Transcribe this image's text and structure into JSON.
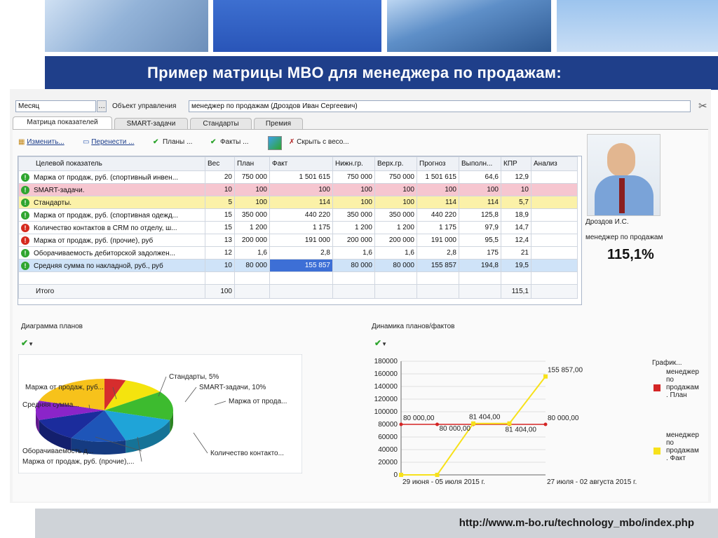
{
  "slide": {
    "title": "Пример матрицы MBO для менеджера по продажам:",
    "url": "http://www.m-bo.ru/technology_mbo/index.php"
  },
  "header": {
    "period_value": "Месяц",
    "object_label": "Объект управления",
    "object_value": "менеджер по продажам (Дроздов Иван Сергеевич)"
  },
  "tabs": [
    "Матрица показателей",
    "SMART-задачи",
    "Стандарты",
    "Премия"
  ],
  "toolbar": {
    "edit": "Изменить...",
    "move": "Перенести ...",
    "plans": "Планы ...",
    "facts": "Факты ...",
    "hide": "Скрыть с весо..."
  },
  "table": {
    "columns": [
      "Целевой показатель",
      "Вес",
      "План",
      "Факт",
      "Нижн.гр.",
      "Верх.гр.",
      "Прогноз",
      "Выполн...",
      "КПР",
      "Анализ"
    ],
    "rows": [
      {
        "status": "green",
        "name": "Маржа от продаж, руб. (спортивный инвен...",
        "weight": "20",
        "plan": "750 000",
        "fact": "1 501 615",
        "low": "750 000",
        "high": "750 000",
        "forecast": "1 501 615",
        "done": "64,6",
        "kpr": "12,9",
        "analysis": "",
        "style": ""
      },
      {
        "status": "green",
        "name": "SMART-задачи.",
        "weight": "10",
        "plan": "100",
        "fact": "100",
        "low": "100",
        "high": "100",
        "forecast": "100",
        "done": "100",
        "kpr": "10",
        "analysis": "",
        "style": "pink"
      },
      {
        "status": "green",
        "name": "Стандарты.",
        "weight": "5",
        "plan": "100",
        "fact": "114",
        "low": "100",
        "high": "100",
        "forecast": "114",
        "done": "114",
        "kpr": "5,7",
        "analysis": "",
        "style": "yellow"
      },
      {
        "status": "green",
        "name": "Маржа от продаж, руб. (спортивная одежд...",
        "weight": "15",
        "plan": "350 000",
        "fact": "440 220",
        "low": "350 000",
        "high": "350 000",
        "forecast": "440 220",
        "done": "125,8",
        "kpr": "18,9",
        "analysis": "",
        "style": ""
      },
      {
        "status": "red",
        "name": "Количество контактов в CRM по отделу, ш...",
        "weight": "15",
        "plan": "1 200",
        "fact": "1 175",
        "low": "1 200",
        "high": "1 200",
        "forecast": "1 175",
        "done": "97,9",
        "kpr": "14,7",
        "analysis": "",
        "style": ""
      },
      {
        "status": "red",
        "name": "Маржа от продаж, руб. (прочие), руб",
        "weight": "13",
        "plan": "200 000",
        "fact": "191 000",
        "low": "200 000",
        "high": "200 000",
        "forecast": "191 000",
        "done": "95,5",
        "kpr": "12,4",
        "analysis": "",
        "style": ""
      },
      {
        "status": "green",
        "name": "Оборачиваемость дебиторской задолжен...",
        "weight": "12",
        "plan": "1,6",
        "fact": "2,8",
        "low": "1,6",
        "high": "1,6",
        "forecast": "2,8",
        "done": "175",
        "kpr": "21",
        "analysis": "",
        "style": ""
      },
      {
        "status": "green",
        "name": "Средняя сумма по накладной, руб., руб",
        "weight": "10",
        "plan": "80 000",
        "fact": "155 857",
        "low": "80 000",
        "high": "80 000",
        "forecast": "155 857",
        "done": "194,8",
        "kpr": "19,5",
        "analysis": "",
        "style": "blue"
      }
    ],
    "total": {
      "name": "Итого",
      "weight": "100",
      "kpr": "115,1"
    }
  },
  "employee": {
    "name": "Дроздов И.С.",
    "role": "менеджер по продажам",
    "score": "115,1%"
  },
  "pie_chart": {
    "title": "Диаграмма планов",
    "slices": [
      {
        "label": "Стандарты, 5%",
        "value": 5,
        "color": "#d62d2d"
      },
      {
        "label": "SMART-задачи, 10%",
        "value": 10,
        "color": "#f4e40e"
      },
      {
        "label": "Маржа от прода...",
        "value": 15,
        "color": "#3dbb2f"
      },
      {
        "label": "Количество контакто...",
        "value": 15,
        "color": "#1fa4d8"
      },
      {
        "label": "Маржа от продаж, руб. (прочие),...",
        "value": 13,
        "color": "#1e55b8"
      },
      {
        "label": "Оборачиваемость д...",
        "value": 12,
        "color": "#1b2c9c"
      },
      {
        "label": "Средняя сумма...",
        "value": 10,
        "color": "#8b24c9"
      },
      {
        "label": "Маржа от продаж, руб...",
        "value": 20,
        "color": "#f7c21b"
      }
    ]
  },
  "line_chart": {
    "title": "Динамика планов/фактов",
    "legend_title": "График...",
    "y_ticks": [
      "180000",
      "160000",
      "140000",
      "120000",
      "100000",
      "80000",
      "60000",
      "40000",
      "20000",
      "0"
    ],
    "x_labels": [
      "29 июня - 05 июля 2015 г.",
      "27 июля - 02 августа 2015 г."
    ],
    "series": [
      {
        "name": "менеджер по продажам . План",
        "color": "#d42525",
        "values": [
          80000,
          80000,
          80000,
          80000,
          80000
        ]
      },
      {
        "name": "менеджер по продажам . Факт",
        "color": "#f7e11b",
        "values": [
          0,
          0,
          81404,
          81404,
          155857
        ]
      }
    ],
    "point_labels": [
      "80 000,00",
      "80 000,00",
      "81 404,00",
      "81 404,00",
      "80 000,00",
      "155 857,00"
    ]
  },
  "chart_data": {
    "type": "line",
    "title": "Динамика планов/фактов",
    "x_ticks": [
      "29 июня - 05 июля 2015 г.",
      "27 июля - 02 августа 2015 г."
    ],
    "ylim": [
      0,
      180000
    ],
    "series": [
      {
        "name": "менеджер по продажам . План",
        "values": [
          80000,
          80000,
          80000,
          80000,
          80000
        ]
      },
      {
        "name": "менеджер по продажам . Факт",
        "values": [
          0,
          0,
          81404,
          81404,
          155857
        ]
      }
    ]
  }
}
